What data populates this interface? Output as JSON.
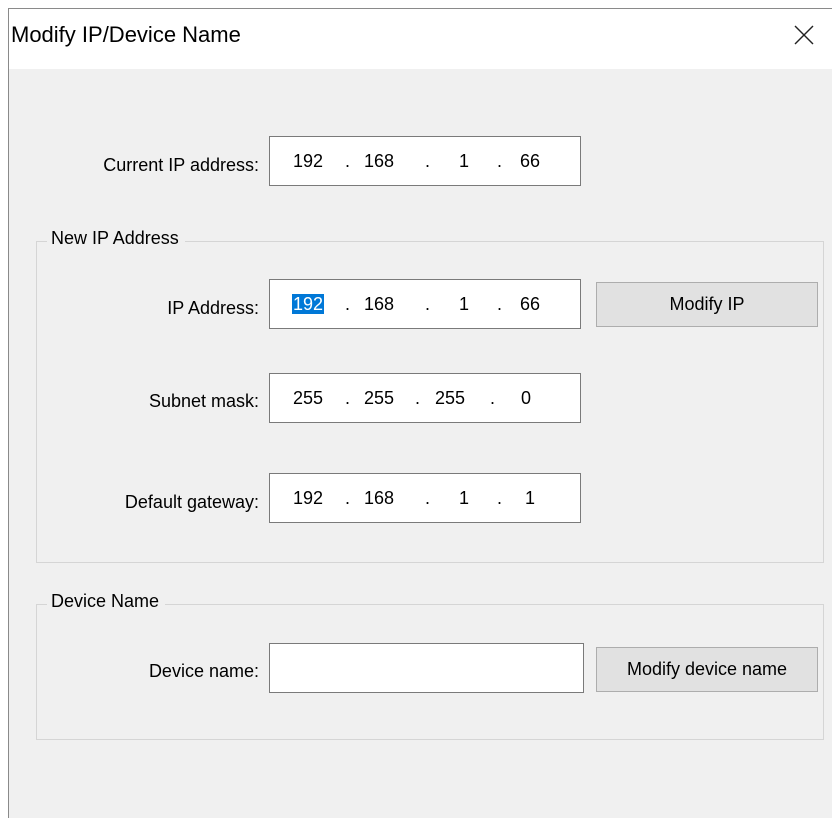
{
  "window": {
    "title": "Modify IP/Device Name"
  },
  "current": {
    "label": "Current IP address:",
    "octets": [
      "192",
      "168",
      "1",
      "66"
    ]
  },
  "new_ip": {
    "group_title": "New IP Address",
    "ip_label": "IP Address:",
    "ip_octets": [
      "192",
      "168",
      "1",
      "66"
    ],
    "subnet_label": "Subnet mask:",
    "subnet_octets": [
      "255",
      "255",
      "255",
      "0"
    ],
    "gateway_label": "Default gateway:",
    "gateway_octets": [
      "192",
      "168",
      "1",
      "1"
    ],
    "modify_button": "Modify IP"
  },
  "device": {
    "group_title": "Device Name",
    "name_label": "Device name:",
    "name_value": "",
    "modify_button": "Modify device name"
  },
  "icons": {
    "close": "close-icon"
  },
  "colors": {
    "selection": "#0078d7",
    "window_bg": "#f0f0f0"
  }
}
